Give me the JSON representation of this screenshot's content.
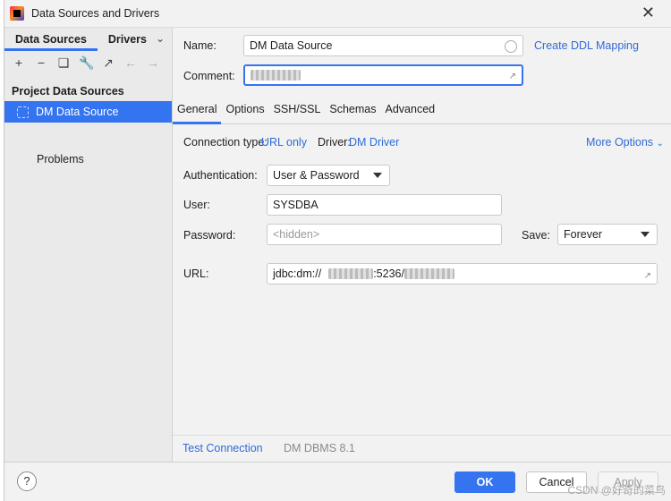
{
  "window": {
    "title": "Data Sources and Drivers",
    "close_glyph": "✕"
  },
  "sidebar": {
    "tabs": [
      {
        "label": "Data Sources",
        "active": true
      },
      {
        "label": "Drivers",
        "active": false
      }
    ],
    "toolbar_icons": [
      "add-icon",
      "remove-icon",
      "duplicate-icon",
      "settings-wrench-icon",
      "navigate-icon",
      "back-arrow-icon",
      "forward-arrow-icon"
    ],
    "section_title": "Project Data Sources",
    "items": [
      {
        "label": "DM Data Source",
        "selected": true
      }
    ],
    "problems_label": "Problems"
  },
  "form": {
    "name_label": "Name:",
    "name_value": "DM Data Source",
    "create_ddl_link": "Create DDL Mapping",
    "comment_label": "Comment:"
  },
  "tabs": [
    {
      "label": "General",
      "active": true
    },
    {
      "label": "Options",
      "active": false
    },
    {
      "label": "SSH/SSL",
      "active": false
    },
    {
      "label": "Schemas",
      "active": false
    },
    {
      "label": "Advanced",
      "active": false
    }
  ],
  "general": {
    "connection_type_label": "Connection type:",
    "connection_type_value": "URL only",
    "driver_label": "Driver:",
    "driver_value": "DM Driver",
    "more_options": "More Options",
    "authentication_label": "Authentication:",
    "authentication_value": "User & Password",
    "user_label": "User:",
    "user_value": "SYSDBA",
    "password_label": "Password:",
    "password_placeholder": "<hidden>",
    "save_label": "Save:",
    "save_value": "Forever",
    "url_label": "URL:",
    "url_prefix": "jdbc:dm://",
    "url_middle": ":5236/"
  },
  "bottom": {
    "test_connection": "Test Connection",
    "dbms_version": "DM DBMS 8.1"
  },
  "footer": {
    "help_glyph": "?",
    "ok": "OK",
    "cancel": "Cancel",
    "apply": "Apply",
    "watermark": "CSDN @好奇的菜鸟"
  },
  "colors": {
    "accent": "#3574f0",
    "link": "#2f6bd8",
    "background": "#f2f2f2"
  }
}
